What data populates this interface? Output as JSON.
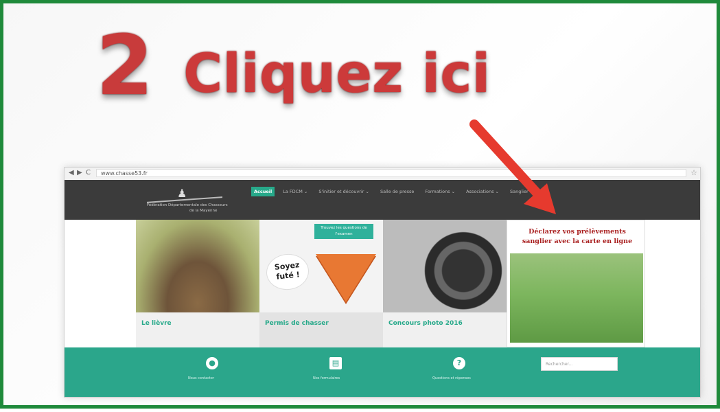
{
  "annotation": {
    "number": "2",
    "text": "Cliquez ici",
    "arrow_color": "#e63a2e",
    "frame_color": "#1f8a3b"
  },
  "browser": {
    "url": "www.chasse53.fr",
    "nav_icons": [
      "back-icon",
      "forward-icon",
      "reload-icon"
    ]
  },
  "site": {
    "logo_text_line1": "Fédération Départementale des Chasseurs",
    "logo_text_line2": "de la Mayenne",
    "menu": [
      {
        "label": "Accueil",
        "active": true
      },
      {
        "label": "La FDCM ⌄",
        "active": false
      },
      {
        "label": "S'initier et découvrir ⌄",
        "active": false
      },
      {
        "label": "Salle de presse",
        "active": false
      },
      {
        "label": "Formations ⌄",
        "active": false
      },
      {
        "label": "Associations ⌄",
        "active": false
      },
      {
        "label": "Sanglier ⌄",
        "active": false
      }
    ],
    "tiles": [
      {
        "label": "Le lièvre"
      },
      {
        "label": "Permis de chasser",
        "badge": "Trouvez les questions de l'examen",
        "bubble": "Soyez futé !"
      },
      {
        "label": "Concours photo 2016"
      },
      {
        "headline": "Déclarez vos prélèvements sanglier avec la carte en ligne"
      }
    ],
    "footer": {
      "items": [
        {
          "icon": "location-pin-icon",
          "caption": "Nous contacter"
        },
        {
          "icon": "document-icon",
          "caption": "Nos formulaires"
        },
        {
          "icon": "help-icon",
          "caption": "Questions et réponses"
        }
      ],
      "search_placeholder": "Rechercher..."
    }
  }
}
